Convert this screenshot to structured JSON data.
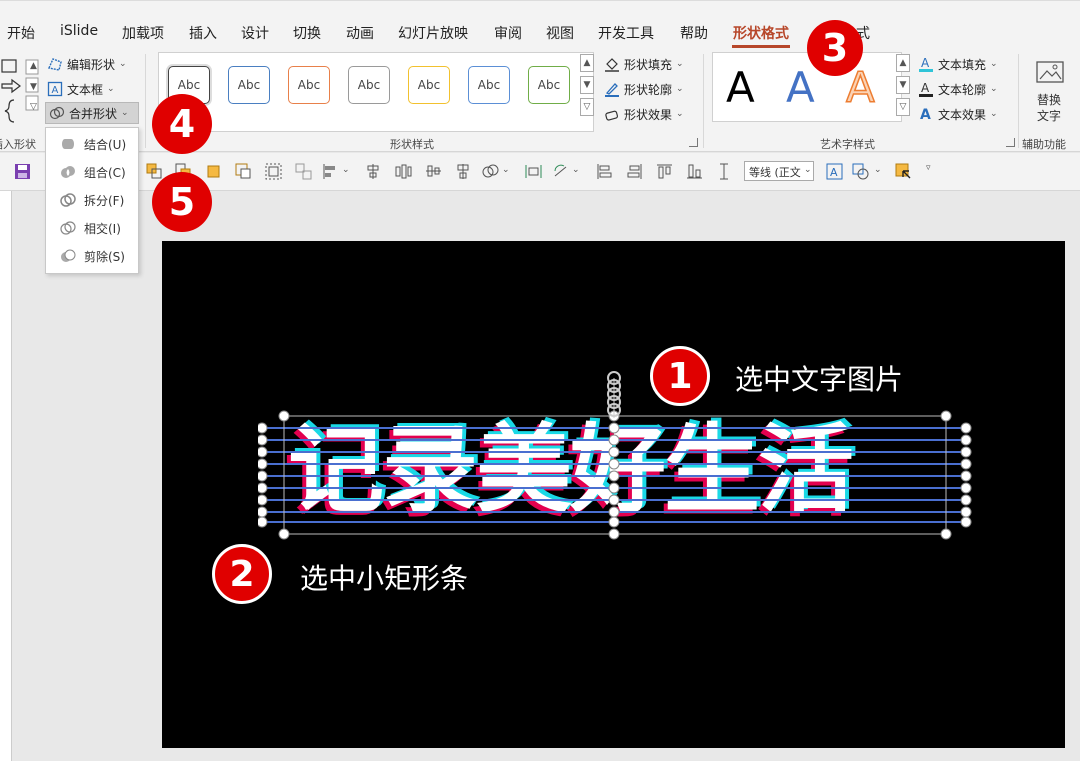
{
  "tabs": [
    {
      "label": "开始",
      "active": false
    },
    {
      "label": "iSlide",
      "active": false
    },
    {
      "label": "加载项",
      "active": false
    },
    {
      "label": "插入",
      "active": false
    },
    {
      "label": "设计",
      "active": false
    },
    {
      "label": "切换",
      "active": false
    },
    {
      "label": "动画",
      "active": false
    },
    {
      "label": "幻灯片放映",
      "active": false
    },
    {
      "label": "审阅",
      "active": false
    },
    {
      "label": "视图",
      "active": false
    },
    {
      "label": "开发工具",
      "active": false
    },
    {
      "label": "帮助",
      "active": false
    },
    {
      "label": "形状格式",
      "active": true
    },
    {
      "label": "式",
      "active": false
    }
  ],
  "insert_shapes": {
    "group_label": "插入形状",
    "edit_shape": "编辑形状",
    "text_box": "文本框",
    "merge_shapes": "合并形状"
  },
  "merge_menu": {
    "items": [
      "结合(U)",
      "组合(C)",
      "拆分(F)",
      "相交(I)",
      "剪除(S)"
    ]
  },
  "shape_styles": {
    "group_label": "形状样式",
    "swatch_text": "Abc",
    "swatch_colors": [
      "#444444",
      "#4a7fc1",
      "#e8804a",
      "#9a9a9a",
      "#f2c12e",
      "#5b8fd6",
      "#70ad47"
    ],
    "fill": "形状填充",
    "outline": "形状轮廓",
    "effects": "形状效果"
  },
  "wordart_styles": {
    "group_label": "艺术字样式",
    "letter": "A",
    "text_fill": "文本填充",
    "text_outline": "文本轮廓",
    "text_effects": "文本效果"
  },
  "accessibility": {
    "alt_text": "替换文字",
    "group_label": "辅助功能"
  },
  "qat": {
    "font_select": "等线 (正文"
  },
  "slide": {
    "art_text": "记录美好生活",
    "callouts": [
      {
        "number": "1",
        "text": "选中文字图片"
      },
      {
        "number": "2",
        "text": "选中小矩形条"
      },
      {
        "number": "3",
        "text": ""
      },
      {
        "number": "4",
        "text": ""
      },
      {
        "number": "5",
        "text": ""
      }
    ]
  },
  "colors": {
    "accent_tab": "#b7472a",
    "badge_red": "#e00000",
    "selection_blue": "#4a6fd0",
    "art_cyan": "#19d9e6",
    "art_red": "#e3004f"
  }
}
